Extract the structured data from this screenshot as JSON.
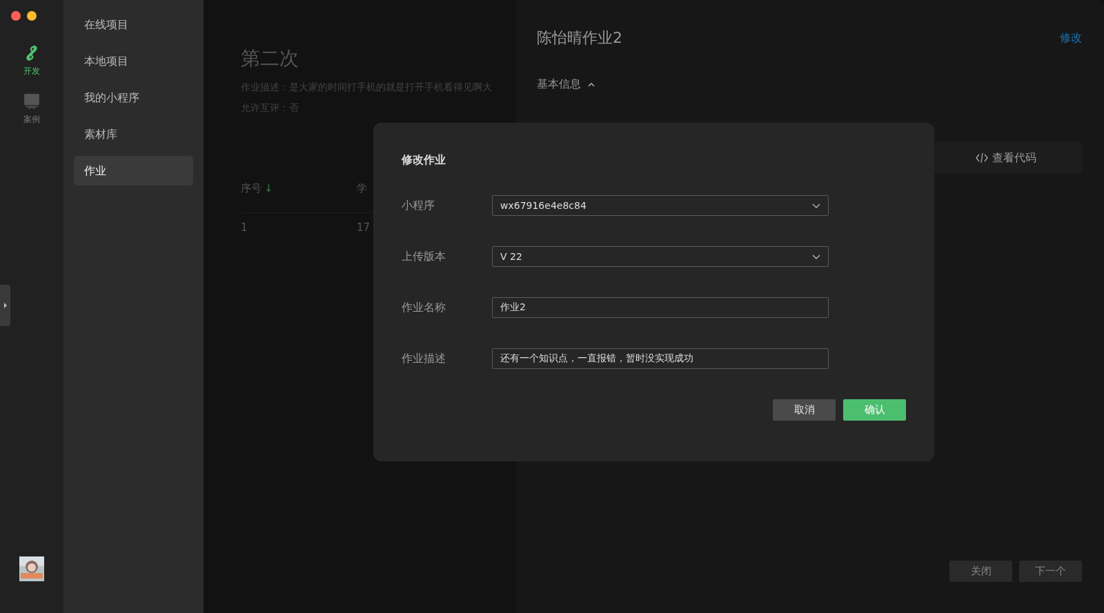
{
  "rail": {
    "items": [
      {
        "label": "开发",
        "kind": "develop",
        "selected": true
      },
      {
        "label": "案例",
        "kind": "cases",
        "selected": false
      }
    ]
  },
  "sidebar": {
    "items": [
      {
        "label": "在线项目",
        "selected": false
      },
      {
        "label": "本地项目",
        "selected": false
      },
      {
        "label": "我的小程序",
        "selected": false
      },
      {
        "label": "素材库",
        "selected": false
      },
      {
        "label": "作业",
        "selected": true
      }
    ]
  },
  "main": {
    "title": "第二次",
    "description": "作业描述：是大家的时间打手机的就是打开手机看得见啊大",
    "peer_review": "允许互评：否",
    "table": {
      "columns": [
        {
          "label": "序号",
          "sort_icon": "↓"
        },
        {
          "label": "学"
        }
      ],
      "rows": [
        [
          "1",
          "17"
        ]
      ]
    }
  },
  "detail": {
    "title": "陈怡晴作业2",
    "edit_link": "修改",
    "section": "基本信息",
    "section_expanded": true,
    "view_code": "查看代码",
    "buttons": [
      "关闭",
      "下一个"
    ]
  },
  "dialog": {
    "title": "修改作业",
    "fields": [
      {
        "label": "小程序",
        "value": "wx67916e4e8c84",
        "kind": "select"
      },
      {
        "label": "上传版本",
        "value": "V 22",
        "kind": "select"
      },
      {
        "label": "作业名称",
        "value": "作业2",
        "kind": "text"
      },
      {
        "label": "作业描述",
        "value": "还有一个知识点，一直报错，暂时没实现成功",
        "kind": "text"
      }
    ],
    "buttons": [
      {
        "label": "取消",
        "kind": "secondary"
      },
      {
        "label": "确认",
        "kind": "primary"
      }
    ]
  }
}
